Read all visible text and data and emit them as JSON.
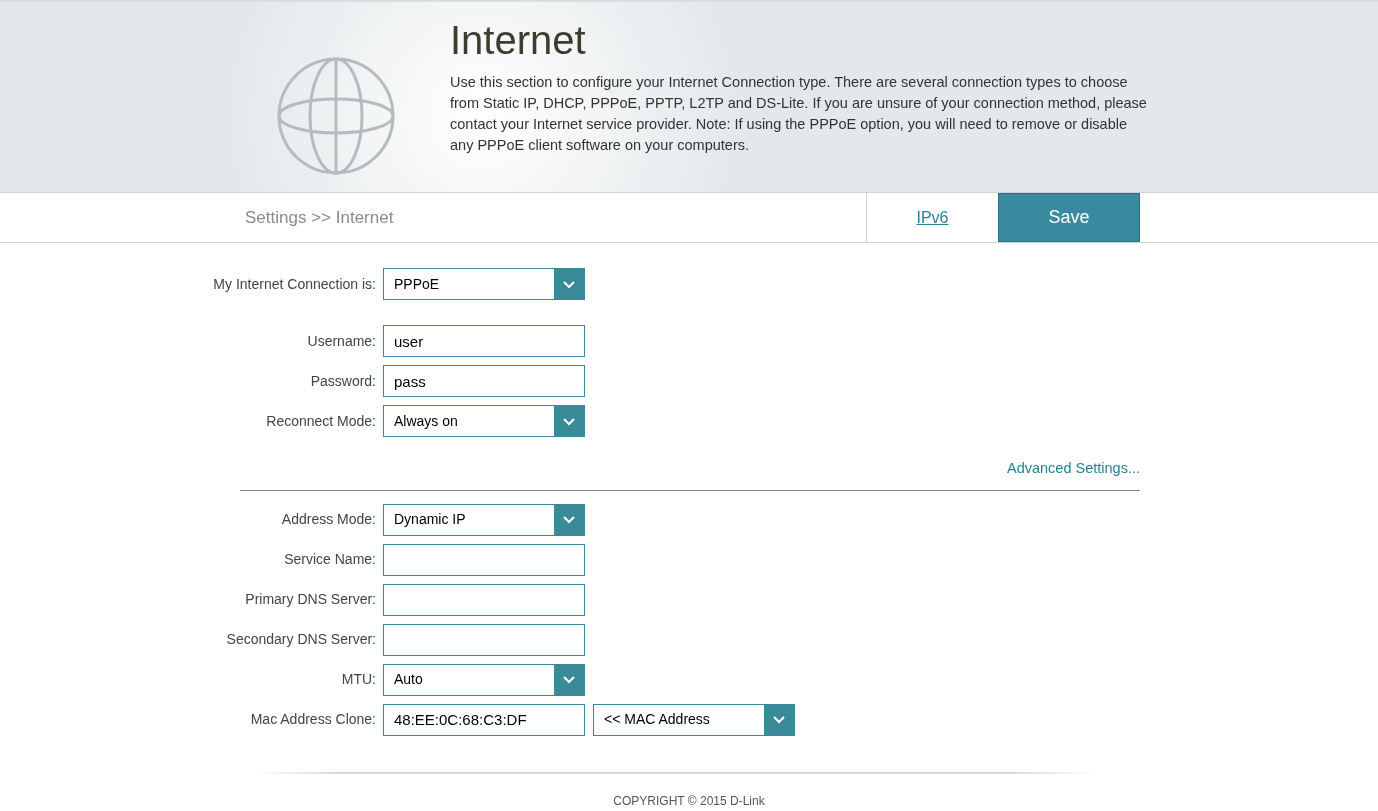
{
  "header": {
    "title": "Internet",
    "description": "Use this section to configure your Internet Connection type. There are several connection types to choose from Static IP, DHCP, PPPoE, PPTP, L2TP and DS-Lite. If you are unsure of your connection method, please contact your Internet service provider. Note: If using the PPPoE option, you will need to remove or disable any PPPoE client software on your computers."
  },
  "nav": {
    "breadcrumb": "Settings >> Internet",
    "ipv6_link": "IPv6",
    "save_button": "Save"
  },
  "connection_fields": [
    {
      "kind": "select",
      "label": "My Internet Connection is:",
      "value": "PPPoE"
    }
  ],
  "account_fields": [
    {
      "kind": "text",
      "label": "Username:",
      "value": "user"
    },
    {
      "kind": "text",
      "label": "Password:",
      "value": "pass"
    },
    {
      "kind": "select",
      "label": "Reconnect Mode:",
      "value": "Always on"
    }
  ],
  "advanced_link": "Advanced Settings...",
  "advanced_fields": [
    {
      "kind": "select",
      "label": "Address Mode:",
      "value": "Dynamic IP"
    },
    {
      "kind": "text",
      "label": "Service Name:"
    },
    {
      "kind": "text",
      "label": "Primary DNS Server:"
    },
    {
      "kind": "text",
      "label": "Secondary DNS Server:"
    },
    {
      "kind": "select",
      "label": "MTU:",
      "value": "Auto"
    },
    {
      "kind": "text",
      "label": "Mac Address Clone:",
      "value": "48:EE:0C:68:C3:DF",
      "extra_select": "<< MAC Address"
    }
  ],
  "footer": "COPYRIGHT © 2015 D-Link"
}
